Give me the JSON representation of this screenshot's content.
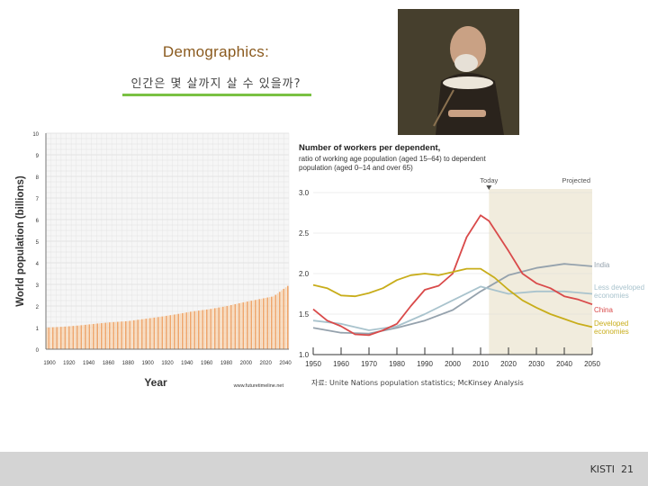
{
  "slide": {
    "title": "Demographics:",
    "subtitle": "인간은 몇 살까지 살 수 있을까?",
    "source": "자료: Unite Nations population statistics; McKinsey Analysis",
    "footer_org": "KISTI",
    "page_number": "21"
  },
  "colors": {
    "title": "#8a5a1e",
    "underline": "#7ac143",
    "pop_bar_light": "#f8d8b6",
    "pop_bar_dark": "#f0a66a",
    "india": "#95a2ad",
    "less_developed": "#a9c3cd",
    "china": "#d94a4a",
    "developed": "#c8ad1a",
    "projected_bg": "#f1ecdd"
  },
  "chart_data": [
    {
      "type": "bar",
      "title": "",
      "xlabel": "Year",
      "ylabel": "World population (billions)",
      "xlim": [
        1900,
        2050
      ],
      "ylim": [
        0,
        10
      ],
      "x_ticks": [
        "1900",
        "1920",
        "1940",
        "1860",
        "1880",
        "1900",
        "1920",
        "1940",
        "1960",
        "1980",
        "2000",
        "2020",
        "2040"
      ],
      "y_ticks": [
        "0",
        "1",
        "2",
        "3",
        "4",
        "5",
        "6",
        "7",
        "8",
        "9",
        "10"
      ],
      "watermark": "www.futuretimeline.net",
      "x": [
        1900,
        1910,
        1920,
        1930,
        1940,
        1950,
        1960,
        1970,
        1980,
        1990,
        2000,
        2010,
        2020,
        2030,
        2040,
        2050
      ],
      "values": [
        1.0,
        1.04,
        1.1,
        1.18,
        1.25,
        1.3,
        1.4,
        1.5,
        1.62,
        1.75,
        1.85,
        1.98,
        2.15,
        2.3,
        2.45,
        3.0
      ]
    },
    {
      "type": "line",
      "title": "Number of workers per dependent,",
      "subtitle": "ratio of working age population (aged 15–64) to dependent population (aged 0–14 and over 65)",
      "annotations": [
        "Today",
        "Projected"
      ],
      "x_ticks": [
        "1950",
        "1960",
        "1970",
        "1980",
        "1990",
        "2000",
        "2010",
        "2020",
        "2030",
        "2040",
        "2050"
      ],
      "y_ticks": [
        "1.0",
        "1.5",
        "2.0",
        "2.5",
        "3.0"
      ],
      "xlim": [
        1950,
        2050
      ],
      "ylim": [
        1.0,
        3.0
      ],
      "projected_from": 2013,
      "series": [
        {
          "name": "India",
          "x": [
            1950,
            1960,
            1970,
            1980,
            1990,
            2000,
            2010,
            2020,
            2030,
            2040,
            2050
          ],
          "values": [
            1.33,
            1.27,
            1.26,
            1.33,
            1.42,
            1.55,
            1.78,
            1.98,
            2.07,
            2.12,
            2.09
          ]
        },
        {
          "name": "Less developed economies",
          "x": [
            1950,
            1960,
            1970,
            1980,
            1990,
            2000,
            2010,
            2020,
            2030,
            2040,
            2050
          ],
          "values": [
            1.42,
            1.38,
            1.3,
            1.35,
            1.5,
            1.67,
            1.84,
            1.75,
            1.78,
            1.78,
            1.75
          ]
        },
        {
          "name": "China",
          "x": [
            1950,
            1955,
            1960,
            1965,
            1970,
            1975,
            1980,
            1985,
            1990,
            1995,
            2000,
            2005,
            2010,
            2013,
            2020,
            2025,
            2030,
            2035,
            2040,
            2045,
            2050
          ],
          "values": [
            1.56,
            1.42,
            1.35,
            1.25,
            1.24,
            1.3,
            1.38,
            1.6,
            1.8,
            1.85,
            2.0,
            2.45,
            2.72,
            2.65,
            2.28,
            2.0,
            1.88,
            1.82,
            1.72,
            1.68,
            1.62
          ]
        },
        {
          "name": "Developed economies",
          "x": [
            1950,
            1955,
            1960,
            1965,
            1970,
            1975,
            1980,
            1985,
            1990,
            1995,
            2000,
            2005,
            2010,
            2015,
            2020,
            2025,
            2030,
            2035,
            2040,
            2045,
            2050
          ],
          "values": [
            1.86,
            1.82,
            1.73,
            1.72,
            1.76,
            1.82,
            1.92,
            1.98,
            2.0,
            1.98,
            2.02,
            2.06,
            2.06,
            1.95,
            1.8,
            1.67,
            1.58,
            1.5,
            1.44,
            1.38,
            1.34
          ]
        }
      ]
    }
  ]
}
